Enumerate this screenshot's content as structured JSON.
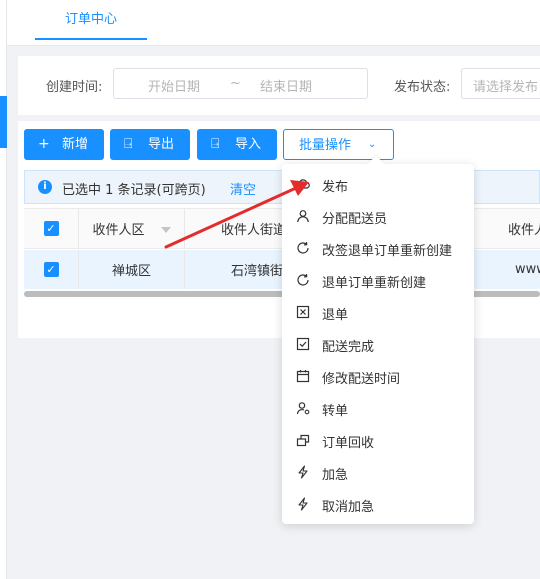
{
  "tabs": {
    "active": "订单中心"
  },
  "filter": {
    "created_label": "创建时间:",
    "start_placeholder": "开始日期",
    "separator": "~",
    "end_placeholder": "结束日期",
    "status_label": "发布状态:",
    "status_placeholder": "请选择发布"
  },
  "toolbar": {
    "add": "新增",
    "export": "导出",
    "import": "导入",
    "batch": "批量操作"
  },
  "selection": {
    "text": "已选中 1 条记录(可跨页)",
    "clear": "清空"
  },
  "table": {
    "headers": [
      "收件人区",
      "收件人街道",
      "收件人"
    ],
    "rows": [
      {
        "district": "禅城区",
        "street": "石湾镇街",
        "recipient": "www"
      }
    ]
  },
  "batch_menu": {
    "items": [
      {
        "label": "发布",
        "icon": "cloud-icon"
      },
      {
        "label": "分配配送员",
        "icon": "user-icon"
      },
      {
        "label": "改签退单订单重新创建",
        "icon": "refresh-icon"
      },
      {
        "label": "退单订单重新创建",
        "icon": "refresh-icon"
      },
      {
        "label": "退单",
        "icon": "close-square-icon"
      },
      {
        "label": "配送完成",
        "icon": "check-square-icon"
      },
      {
        "label": "修改配送时间",
        "icon": "calendar-icon"
      },
      {
        "label": "转单",
        "icon": "user-transfer-icon"
      },
      {
        "label": "订单回收",
        "icon": "recycle-icon"
      },
      {
        "label": "加急",
        "icon": "lightning-icon"
      },
      {
        "label": "取消加急",
        "icon": "lightning-icon"
      }
    ]
  },
  "colors": {
    "primary": "#1890ff",
    "annotation_arrow": "#e52b2b"
  }
}
